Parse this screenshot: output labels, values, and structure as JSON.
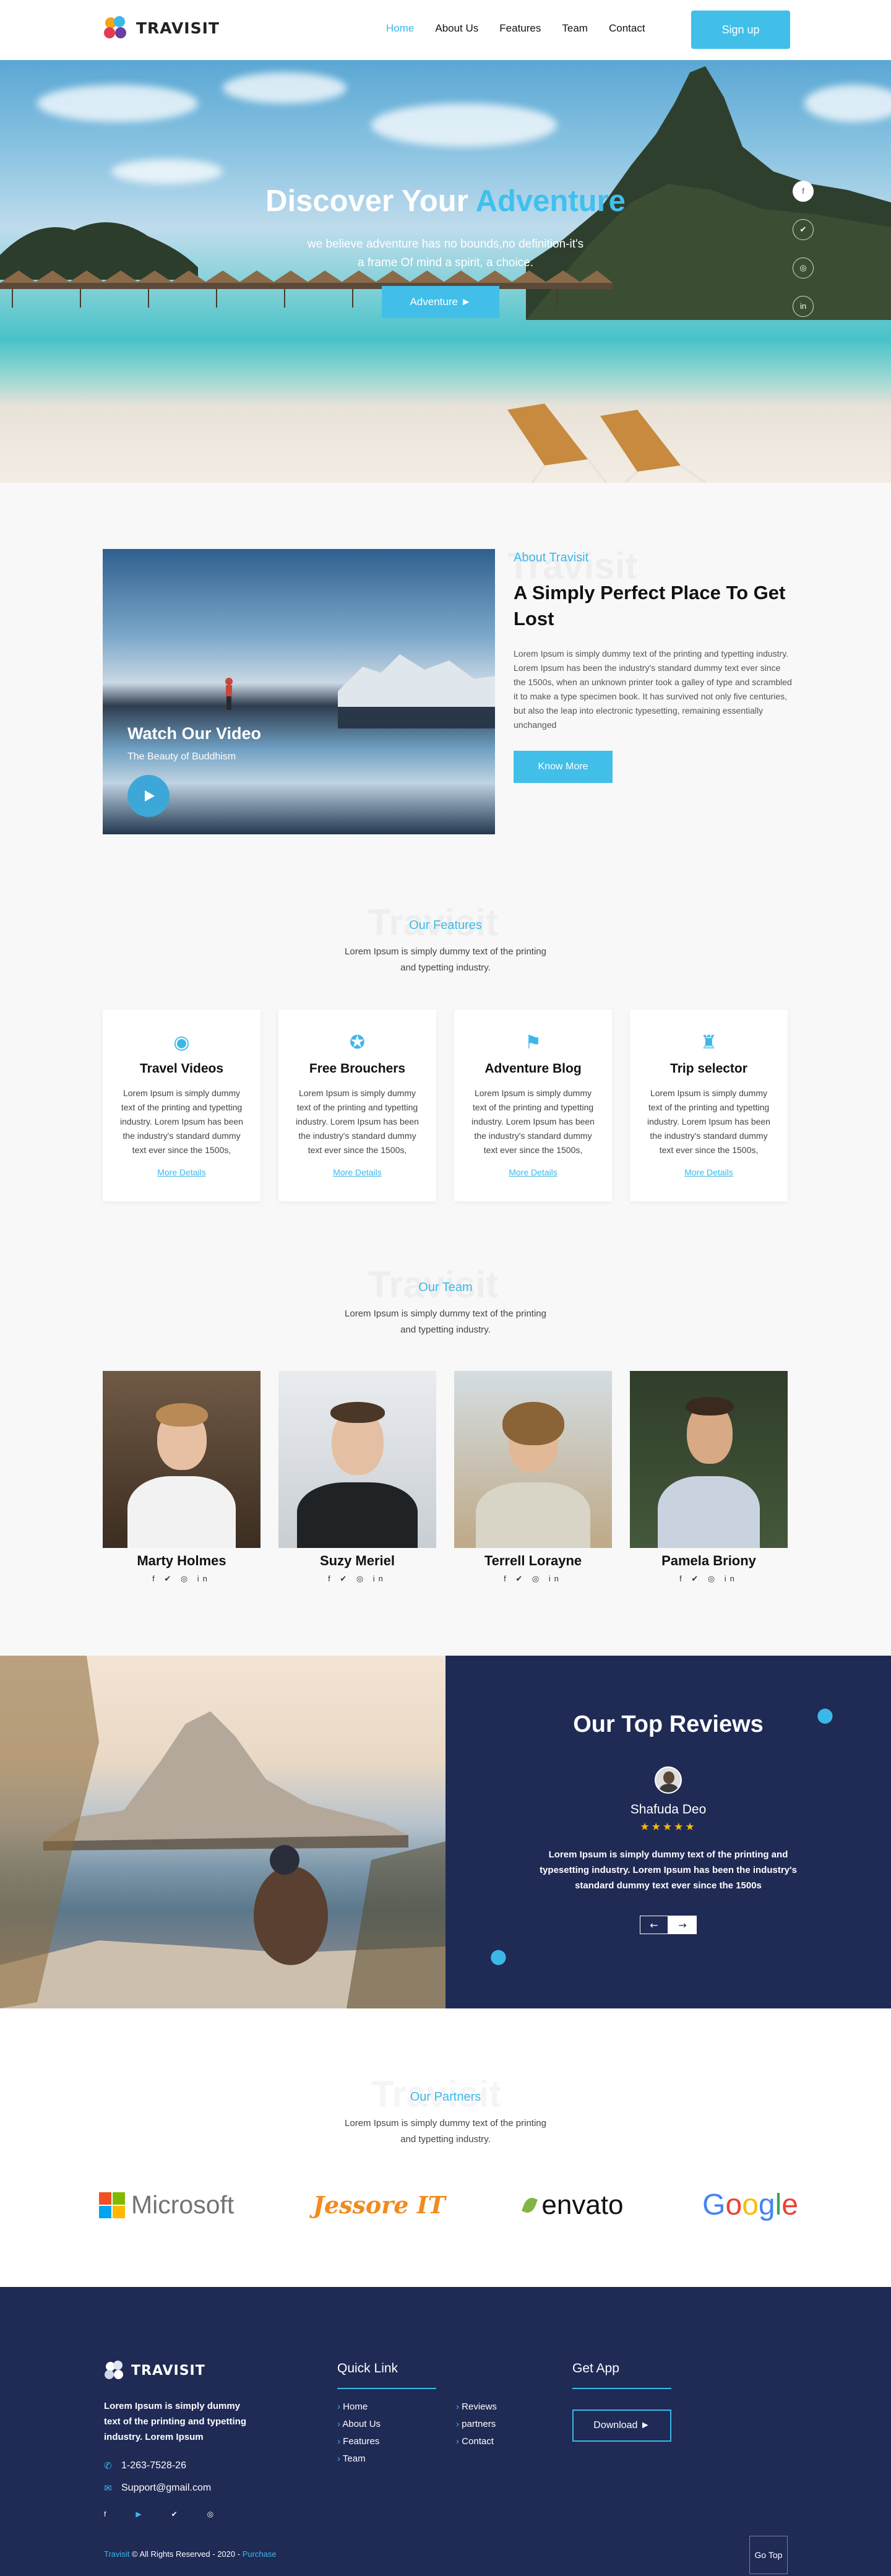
{
  "brand": {
    "name": "TRAVISIT"
  },
  "nav": {
    "items": [
      {
        "label": "Home",
        "active": true
      },
      {
        "label": "About Us"
      },
      {
        "label": "Features"
      },
      {
        "label": "Team"
      },
      {
        "label": "Contact"
      }
    ],
    "signup_label": "Sign up"
  },
  "hero": {
    "title_part1": "Discover Your ",
    "title_highlight": "Adventure",
    "subtitle_line1": "we believe adventure has no bounds,no definition-it's",
    "subtitle_line2": "a frame Of mind a spirit, a choice.",
    "cta_label": "Adventure  ►",
    "social": [
      "facebook-icon",
      "twitter-icon",
      "instagram-icon",
      "linkedin-icon"
    ]
  },
  "about": {
    "watermark": "Travisit",
    "video_title": "Watch Our Video",
    "video_subtitle": "The Beauty of Buddhism",
    "kicker": "About Travisit",
    "title": "A Simply Perfect Place To Get Lost",
    "body": "Lorem Ipsum is simply dummy text of the printing and typetting industry. Lorem Ipsum has been the industry's standard dummy text ever since the 1500s, when an unknown printer took a galley of type and scrambled it to make a type specimen book. It has survived not only five centuries, but also the leap into electronic typesetting, remaining essentially unchanged",
    "button_label": "Know More"
  },
  "features": {
    "watermark": "Travisit",
    "kicker": "Our Features",
    "desc_line1": "Lorem Ipsum is simply dummy text of the printing",
    "desc_line2": "and typetting industry.",
    "cards": [
      {
        "icon": "camera-icon",
        "title": "Travel Videos",
        "text": "Lorem Ipsum is simply dummy text of the printing and typetting industry. Lorem Ipsum has been the industry's standard dummy text ever since the 1500s,",
        "link": "More Details"
      },
      {
        "icon": "compass-icon",
        "title": "Free Brouchers",
        "text": "Lorem Ipsum is simply dummy text of the printing and typetting industry. Lorem Ipsum has been the industry's standard dummy text ever since the 1500s,",
        "link": "More Details"
      },
      {
        "icon": "mountain-flag-icon",
        "title": "Adventure Blog",
        "text": "Lorem Ipsum is simply dummy text of the printing and typetting industry. Lorem Ipsum has been the industry's standard dummy text ever since the 1500s,",
        "link": "More Details"
      },
      {
        "icon": "castle-icon",
        "title": "Trip selector",
        "text": "Lorem Ipsum is simply dummy text of the printing and typetting industry. Lorem Ipsum has been the industry's standard dummy text ever since the 1500s,",
        "link": "More Details"
      }
    ]
  },
  "team": {
    "watermark": "Travisit",
    "kicker": "Our Team",
    "desc_line1": "Lorem Ipsum is simply dummy text of the printing",
    "desc_line2": "and typetting industry.",
    "members": [
      {
        "name": "Marty Holmes",
        "social": "f ✔ ◎ in"
      },
      {
        "name": "Suzy Meriel",
        "social": "f ✔ ◎ in"
      },
      {
        "name": "Terrell Lorayne",
        "social": "f ✔ ◎ in"
      },
      {
        "name": "Pamela Briony",
        "social": "f ✔ ◎ in"
      }
    ]
  },
  "reviews": {
    "title": "Our Top Reviews",
    "reviewer": "Shafuda Deo",
    "stars": "★★★★★",
    "text": "Lorem Ipsum is simply dummy text of the printing and typesetting industry. Lorem Ipsum has been the industry's standard dummy text ever since the 1500s",
    "prev": "←",
    "next": "→"
  },
  "partners": {
    "watermark": "Travisit",
    "kicker": "Our Partners",
    "desc_line1": "Lorem Ipsum is simply dummy text of the printing",
    "desc_line2": "and typetting industry.",
    "logos": {
      "microsoft": "Microsoft",
      "jessore": "Jessore IT",
      "envato": "envato",
      "google": "Google"
    }
  },
  "footer": {
    "brand": "TRAVISIT",
    "about": "Lorem Ipsum is simply dummy text of the printing and typetting industry. Lorem Ipsum",
    "phone": "1-263-7528-26",
    "email": "Support@gmail.com",
    "quick_link_title": "Quick Link",
    "links_col1": [
      "Home",
      "About Us",
      "Features",
      "Team"
    ],
    "links_col2": [
      "Reviews",
      "partners",
      "Contact"
    ],
    "get_app_title": "Get App",
    "download_label": "Download  ►",
    "copyright_brand": "Travisit",
    "copyright_text": " © All Rights Reserved - 2020 - ",
    "copyright_link": "Purchase",
    "go_top": "Go Top"
  },
  "colors": {
    "accent": "#41bfe9",
    "navy": "#1f2a55",
    "star": "#f5b90a"
  }
}
